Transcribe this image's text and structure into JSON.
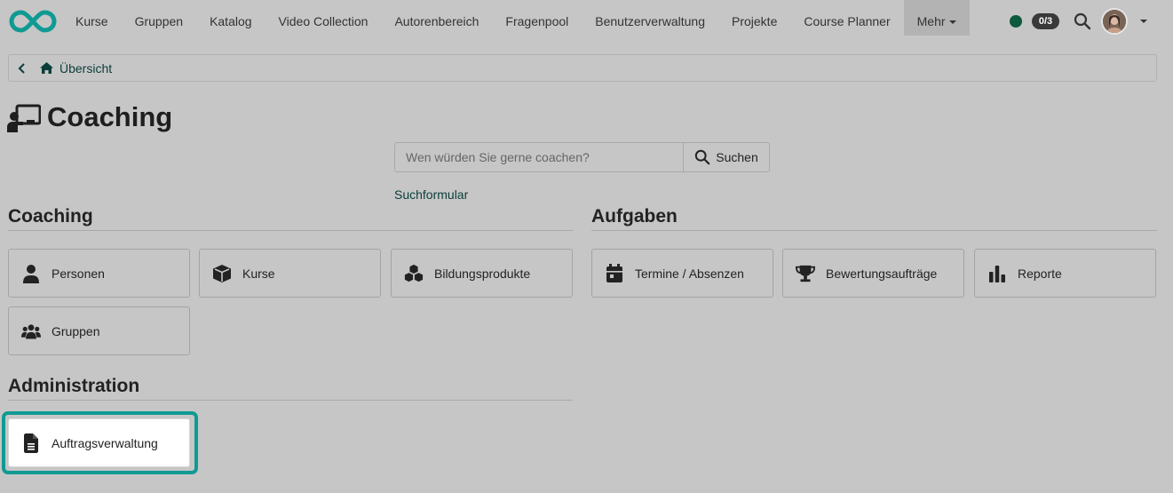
{
  "nav": {
    "items": [
      "Kurse",
      "Gruppen",
      "Katalog",
      "Video Collection",
      "Autorenbereich",
      "Fragenpool",
      "Benutzerverwaltung",
      "Projekte",
      "Course Planner"
    ],
    "more_label": "Mehr",
    "badge": "0/3"
  },
  "breadcrumb": {
    "label": "Übersicht"
  },
  "page": {
    "title": "Coaching"
  },
  "search": {
    "placeholder": "Wen würden Sie gerne coachen?",
    "button_label": "Suchen",
    "form_link": "Suchformular"
  },
  "sections": {
    "coaching": {
      "title": "Coaching",
      "tiles": [
        "Personen",
        "Kurse",
        "Bildungsprodukte",
        "Gruppen"
      ]
    },
    "aufgaben": {
      "title": "Aufgaben",
      "tiles": [
        "Termine / Absenzen",
        "Bewertungsaufträge",
        "Reporte"
      ]
    },
    "administration": {
      "title": "Administration",
      "tiles": [
        "Auftragsverwaltung"
      ]
    }
  },
  "icons": {
    "logo": "infinity-logo-icon",
    "status": "status-dot-icon",
    "search": "search-icon",
    "personen": "user-icon",
    "kurse": "cube-icon",
    "bildungsprodukte": "cubes-icon",
    "gruppen": "users-icon",
    "termine": "calendar-icon",
    "bewertung": "trophy-icon",
    "reporte": "bar-chart-icon",
    "auftrag": "document-icon"
  },
  "colors": {
    "brand": "#0f9a93",
    "link": "#0a3d3a",
    "status_online": "#0d5a3c",
    "highlight": "#0f9a93"
  }
}
